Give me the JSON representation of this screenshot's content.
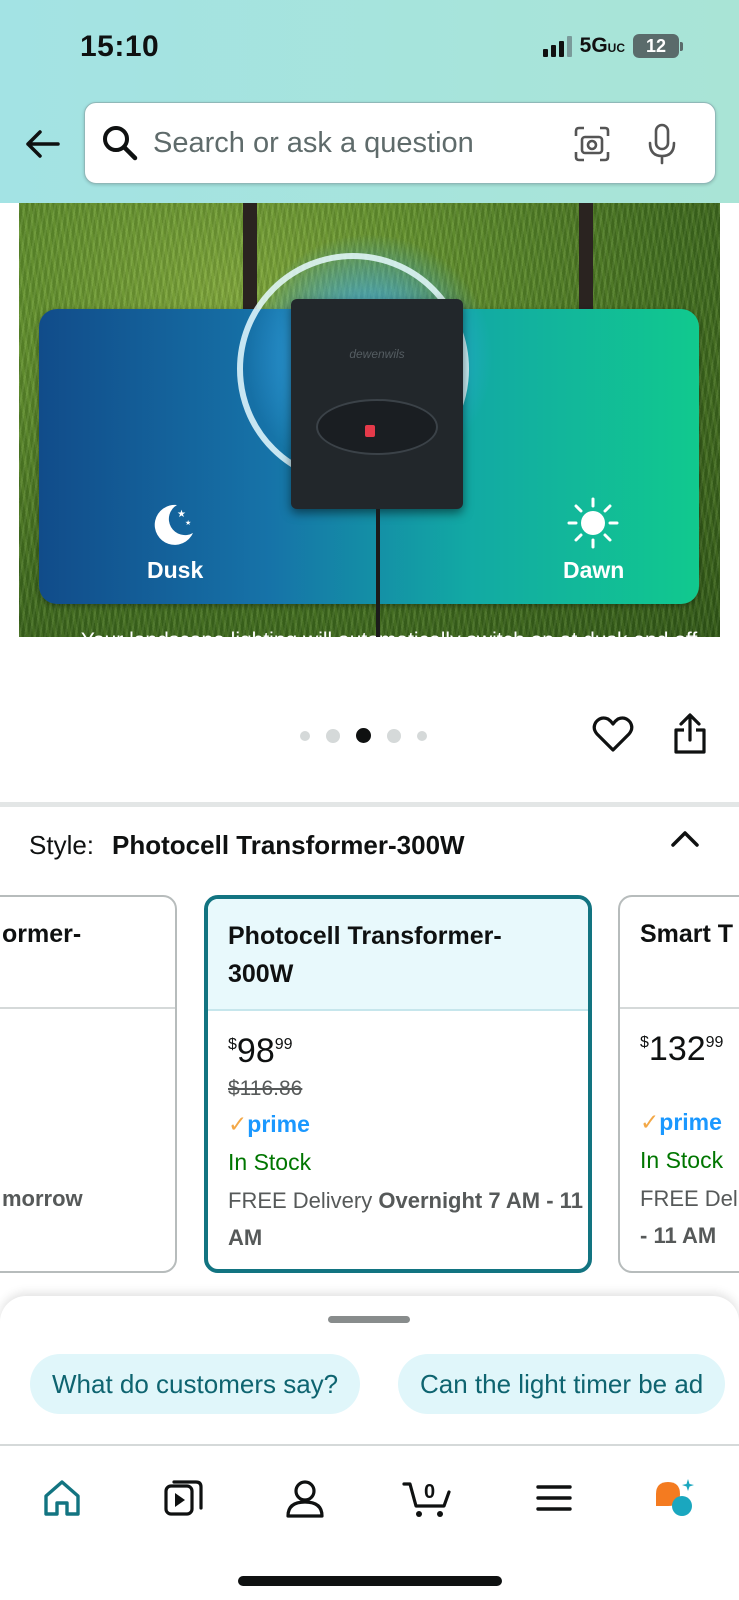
{
  "status_bar": {
    "time": "15:10",
    "network": "5G",
    "network_suffix": "UC",
    "battery": "12"
  },
  "search": {
    "placeholder": "Search or ask a question"
  },
  "hero": {
    "brand": "dewenwils",
    "dusk_label": "Dusk",
    "dawn_label": "Dawn",
    "caption": "Your landscape lighting will automatically switch on at dusk and off at dawn.",
    "carousel_total": 5,
    "carousel_active": 3
  },
  "style": {
    "label": "Style:",
    "value": "Photocell Transformer-300W"
  },
  "cards": [
    {
      "title": "ormer-",
      "price": {
        "symbol": "",
        "whole": "",
        "fraction": ""
      },
      "was": "",
      "prime": "",
      "stock": "",
      "delivery_prefix": "",
      "delivery_bold": "morrow"
    },
    {
      "title": "Photocell Transformer-300W",
      "price": {
        "symbol": "$",
        "whole": "98",
        "fraction": "99"
      },
      "was": "$116.86",
      "prime": "prime",
      "stock": "In Stock",
      "delivery_prefix": "FREE Delivery ",
      "delivery_bold": "Overnight 7 AM - 11 AM"
    },
    {
      "title": "Smart T",
      "price": {
        "symbol": "$",
        "whole": "132",
        "fraction": "99"
      },
      "was": "",
      "prime": "prime",
      "stock": "In Stock",
      "delivery_prefix": "FREE Deli",
      "delivery_bold": "- 11 AM"
    }
  ],
  "chips": [
    "What do customers say?",
    "Can the light timer be ad"
  ],
  "nav": {
    "cart_count": "0"
  },
  "colors": {
    "teal": "#127481",
    "prime_blue": "#1a98ff",
    "stock_green": "#007600",
    "header": "#a5e3e0"
  }
}
